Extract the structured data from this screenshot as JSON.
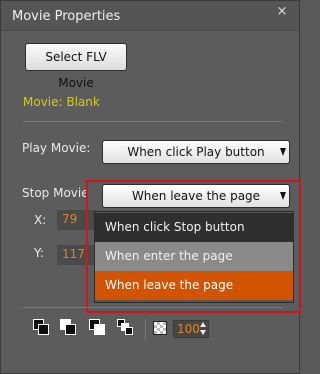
{
  "window": {
    "title": "Movie Properties",
    "close_icon": "×"
  },
  "buttons": {
    "select_flv": "Select FLV Movie"
  },
  "status": {
    "movie": "Movie: Blank",
    "color": "#d7d000"
  },
  "fields": {
    "play_label": "Play Movie:",
    "play_value": "When click Play button",
    "stop_label": "Stop Movie",
    "stop_value": "When leave the page"
  },
  "dropdown": {
    "options": [
      "When click Stop button",
      "When enter the page",
      "When leave the page"
    ],
    "selected": "When leave the page",
    "selected_color": "#d35400"
  },
  "position": {
    "x_label": "X:",
    "x_value": "79",
    "y_label": "Y:",
    "y_value": "117"
  },
  "tools": {
    "icons": [
      "bring-forward-icon",
      "send-backward-icon",
      "bring-to-front-icon",
      "send-to-back-icon",
      "opacity-checker-icon"
    ],
    "opacity": "100"
  },
  "accent": {
    "highlight_border": "#d2141c",
    "value_text": "#e2861a"
  }
}
